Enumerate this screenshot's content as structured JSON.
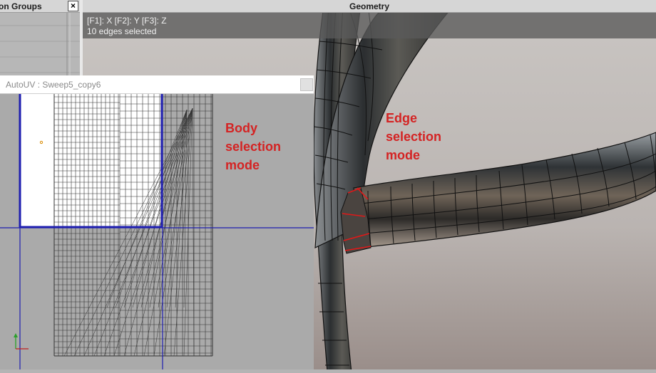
{
  "left_panel": {
    "title": "on Groups",
    "close_glyph": "×"
  },
  "geometry": {
    "title": "Geometry",
    "hud": {
      "axes": "[F1]: X     [F2]: Y     [F3]: Z",
      "status": "10 edges selected"
    }
  },
  "autouv": {
    "title": "AutoUV : Sweep5_copy6"
  },
  "annotations": {
    "body": [
      "Body",
      "selection",
      "mode"
    ],
    "edge": [
      "Edge",
      "selection",
      "mode"
    ]
  },
  "colors": {
    "annotation": "#d42323",
    "uv_boundary": "#1f1fb0",
    "selected_edge": "#e01818"
  },
  "icons": [
    "close-icon",
    "axis-gizmo-icon"
  ]
}
